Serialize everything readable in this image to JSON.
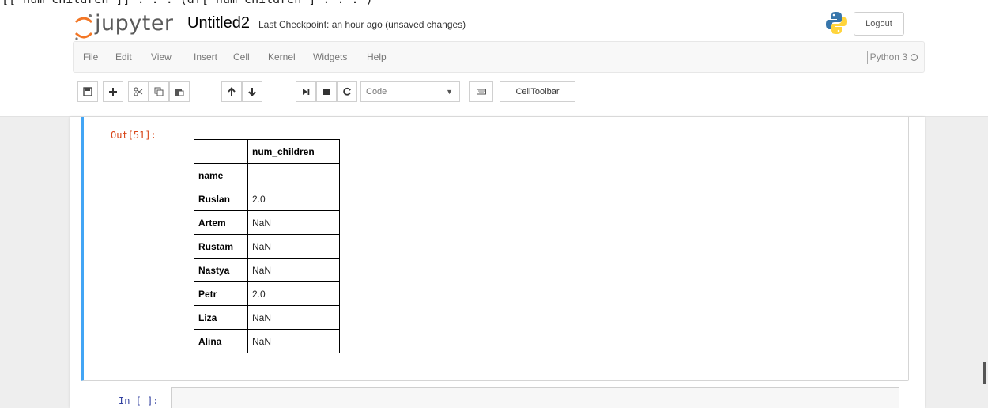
{
  "top_code_fragment": "[[\"num_children\"]]  . . .  (df[\"num_children\"] . . . )",
  "header": {
    "logo_text": "jupyter",
    "notebook_name": "Untitled2",
    "checkpoint": "Last Checkpoint: an hour ago (unsaved changes)",
    "logout": "Logout"
  },
  "menu": {
    "items": [
      "File",
      "Edit",
      "View",
      "Insert",
      "Cell",
      "Kernel",
      "Widgets",
      "Help"
    ],
    "kernel_name": "Python 3"
  },
  "toolbar": {
    "icons": [
      "save-icon",
      "plus-icon",
      "cut-icon",
      "copy-icon",
      "paste-icon",
      "arrow-up-icon",
      "arrow-down-icon",
      "step-forward-icon",
      "stop-icon",
      "restart-icon"
    ],
    "cell_type": "Code",
    "keyboard_icon": "keyboard-icon",
    "celltoolbar": "CellToolbar"
  },
  "output_cell": {
    "prompt": "Out[51]:",
    "table": {
      "columns": [
        "",
        "num_children"
      ],
      "index_name": "name",
      "rows": [
        [
          "Ruslan",
          "2.0"
        ],
        [
          "Artem",
          "NaN"
        ],
        [
          "Rustam",
          "NaN"
        ],
        [
          "Nastya",
          "NaN"
        ],
        [
          "Petr",
          "2.0"
        ],
        [
          "Liza",
          "NaN"
        ],
        [
          "Alina",
          "NaN"
        ]
      ]
    }
  },
  "input_cell": {
    "prompt": "In [ ]:"
  },
  "colors": {
    "selected_cell_border": "#42a5f5",
    "out_prompt": "#d84315",
    "in_prompt": "#303f9f"
  }
}
